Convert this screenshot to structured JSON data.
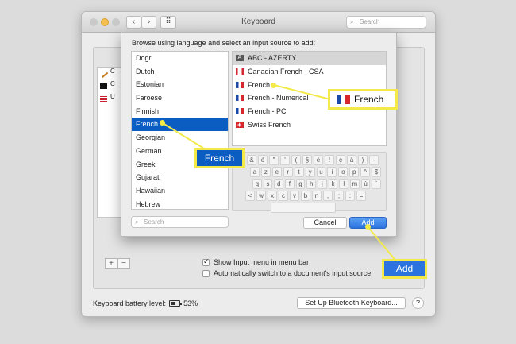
{
  "window": {
    "title": "Keyboard",
    "back": "‹",
    "forward": "›",
    "grid": "⠿",
    "search_placeholder": "Search"
  },
  "left_list": {
    "items": [
      {
        "label": "C",
        "icon": "pencil-icon"
      },
      {
        "label": "C",
        "icon": "black-square-icon"
      },
      {
        "label": "U",
        "icon": "us-flag-icon"
      }
    ]
  },
  "controls": {
    "add": "+",
    "remove": "−"
  },
  "options": {
    "show_input_menu": {
      "label": "Show Input menu in menu bar",
      "checked": true
    },
    "auto_switch": {
      "label": "Automatically switch to a document's input source",
      "checked": false
    }
  },
  "footer": {
    "battery_label": "Keyboard battery level:",
    "battery_level": "53%",
    "battery_fraction": 0.53,
    "bluetooth_button": "Set Up Bluetooth Keyboard...",
    "help": "?"
  },
  "sheet": {
    "title": "Browse using language and select an input source to add:",
    "languages": [
      "Dogri",
      "Dutch",
      "Estonian",
      "Faroese",
      "Finnish",
      "French",
      "Georgian",
      "German",
      "Greek",
      "Gujarati",
      "Hawaiian",
      "Hebrew"
    ],
    "selected_language": "French",
    "sources": [
      {
        "label": "ABC - AZERTY",
        "flag": "abc",
        "flag_text": "A"
      },
      {
        "label": "Canadian French - CSA",
        "flag": "ca"
      },
      {
        "label": "French",
        "flag": "fr"
      },
      {
        "label": "French - Numerical",
        "flag": "fr"
      },
      {
        "label": "French - PC",
        "flag": "fr"
      },
      {
        "label": "Swiss French",
        "flag": "ch"
      }
    ],
    "keyboard_rows": [
      [
        "&",
        "é",
        "\"",
        "'",
        "(",
        "§",
        "è",
        "!",
        "ç",
        "à",
        ")",
        "-"
      ],
      [
        "a",
        "z",
        "e",
        "r",
        "t",
        "y",
        "u",
        "i",
        "o",
        "p",
        "^",
        "$"
      ],
      [
        "q",
        "s",
        "d",
        "f",
        "g",
        "h",
        "j",
        "k",
        "l",
        "m",
        "ù",
        "`"
      ],
      [
        "<",
        "w",
        "x",
        "c",
        "v",
        "b",
        "n",
        ",",
        ";",
        ":",
        "="
      ]
    ],
    "search_placeholder": "Search",
    "cancel": "Cancel",
    "add": "Add"
  },
  "callouts": {
    "source": "French",
    "language": "French",
    "add": "Add"
  }
}
